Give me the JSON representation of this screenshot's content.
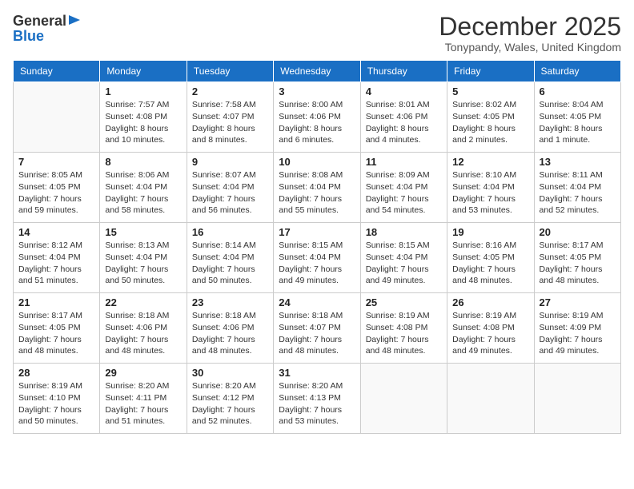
{
  "header": {
    "logo_general": "General",
    "logo_blue": "Blue",
    "month_title": "December 2025",
    "location": "Tonypandy, Wales, United Kingdom"
  },
  "weekdays": [
    "Sunday",
    "Monday",
    "Tuesday",
    "Wednesday",
    "Thursday",
    "Friday",
    "Saturday"
  ],
  "weeks": [
    [
      {
        "day": "",
        "info": ""
      },
      {
        "day": "1",
        "info": "Sunrise: 7:57 AM\nSunset: 4:08 PM\nDaylight: 8 hours\nand 10 minutes."
      },
      {
        "day": "2",
        "info": "Sunrise: 7:58 AM\nSunset: 4:07 PM\nDaylight: 8 hours\nand 8 minutes."
      },
      {
        "day": "3",
        "info": "Sunrise: 8:00 AM\nSunset: 4:06 PM\nDaylight: 8 hours\nand 6 minutes."
      },
      {
        "day": "4",
        "info": "Sunrise: 8:01 AM\nSunset: 4:06 PM\nDaylight: 8 hours\nand 4 minutes."
      },
      {
        "day": "5",
        "info": "Sunrise: 8:02 AM\nSunset: 4:05 PM\nDaylight: 8 hours\nand 2 minutes."
      },
      {
        "day": "6",
        "info": "Sunrise: 8:04 AM\nSunset: 4:05 PM\nDaylight: 8 hours\nand 1 minute."
      }
    ],
    [
      {
        "day": "7",
        "info": "Sunrise: 8:05 AM\nSunset: 4:05 PM\nDaylight: 7 hours\nand 59 minutes."
      },
      {
        "day": "8",
        "info": "Sunrise: 8:06 AM\nSunset: 4:04 PM\nDaylight: 7 hours\nand 58 minutes."
      },
      {
        "day": "9",
        "info": "Sunrise: 8:07 AM\nSunset: 4:04 PM\nDaylight: 7 hours\nand 56 minutes."
      },
      {
        "day": "10",
        "info": "Sunrise: 8:08 AM\nSunset: 4:04 PM\nDaylight: 7 hours\nand 55 minutes."
      },
      {
        "day": "11",
        "info": "Sunrise: 8:09 AM\nSunset: 4:04 PM\nDaylight: 7 hours\nand 54 minutes."
      },
      {
        "day": "12",
        "info": "Sunrise: 8:10 AM\nSunset: 4:04 PM\nDaylight: 7 hours\nand 53 minutes."
      },
      {
        "day": "13",
        "info": "Sunrise: 8:11 AM\nSunset: 4:04 PM\nDaylight: 7 hours\nand 52 minutes."
      }
    ],
    [
      {
        "day": "14",
        "info": "Sunrise: 8:12 AM\nSunset: 4:04 PM\nDaylight: 7 hours\nand 51 minutes."
      },
      {
        "day": "15",
        "info": "Sunrise: 8:13 AM\nSunset: 4:04 PM\nDaylight: 7 hours\nand 50 minutes."
      },
      {
        "day": "16",
        "info": "Sunrise: 8:14 AM\nSunset: 4:04 PM\nDaylight: 7 hours\nand 50 minutes."
      },
      {
        "day": "17",
        "info": "Sunrise: 8:15 AM\nSunset: 4:04 PM\nDaylight: 7 hours\nand 49 minutes."
      },
      {
        "day": "18",
        "info": "Sunrise: 8:15 AM\nSunset: 4:04 PM\nDaylight: 7 hours\nand 49 minutes."
      },
      {
        "day": "19",
        "info": "Sunrise: 8:16 AM\nSunset: 4:05 PM\nDaylight: 7 hours\nand 48 minutes."
      },
      {
        "day": "20",
        "info": "Sunrise: 8:17 AM\nSunset: 4:05 PM\nDaylight: 7 hours\nand 48 minutes."
      }
    ],
    [
      {
        "day": "21",
        "info": "Sunrise: 8:17 AM\nSunset: 4:05 PM\nDaylight: 7 hours\nand 48 minutes."
      },
      {
        "day": "22",
        "info": "Sunrise: 8:18 AM\nSunset: 4:06 PM\nDaylight: 7 hours\nand 48 minutes."
      },
      {
        "day": "23",
        "info": "Sunrise: 8:18 AM\nSunset: 4:06 PM\nDaylight: 7 hours\nand 48 minutes."
      },
      {
        "day": "24",
        "info": "Sunrise: 8:18 AM\nSunset: 4:07 PM\nDaylight: 7 hours\nand 48 minutes."
      },
      {
        "day": "25",
        "info": "Sunrise: 8:19 AM\nSunset: 4:08 PM\nDaylight: 7 hours\nand 48 minutes."
      },
      {
        "day": "26",
        "info": "Sunrise: 8:19 AM\nSunset: 4:08 PM\nDaylight: 7 hours\nand 49 minutes."
      },
      {
        "day": "27",
        "info": "Sunrise: 8:19 AM\nSunset: 4:09 PM\nDaylight: 7 hours\nand 49 minutes."
      }
    ],
    [
      {
        "day": "28",
        "info": "Sunrise: 8:19 AM\nSunset: 4:10 PM\nDaylight: 7 hours\nand 50 minutes."
      },
      {
        "day": "29",
        "info": "Sunrise: 8:20 AM\nSunset: 4:11 PM\nDaylight: 7 hours\nand 51 minutes."
      },
      {
        "day": "30",
        "info": "Sunrise: 8:20 AM\nSunset: 4:12 PM\nDaylight: 7 hours\nand 52 minutes."
      },
      {
        "day": "31",
        "info": "Sunrise: 8:20 AM\nSunset: 4:13 PM\nDaylight: 7 hours\nand 53 minutes."
      },
      {
        "day": "",
        "info": ""
      },
      {
        "day": "",
        "info": ""
      },
      {
        "day": "",
        "info": ""
      }
    ]
  ]
}
